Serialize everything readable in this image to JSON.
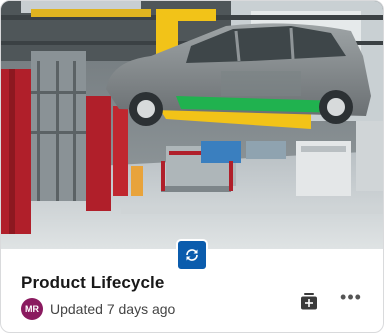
{
  "card": {
    "title": "Product Lifecycle",
    "updated_text": "Updated 7 days ago",
    "owner_initials": "MR",
    "more_label": "•••"
  },
  "icons": {
    "type_badge": "sync-icon",
    "add": "add-to-collection-icon",
    "more": "more-options-icon"
  },
  "colors": {
    "badge": "#0b5cad",
    "avatar": "#8a1a5f",
    "title": "#181818"
  }
}
